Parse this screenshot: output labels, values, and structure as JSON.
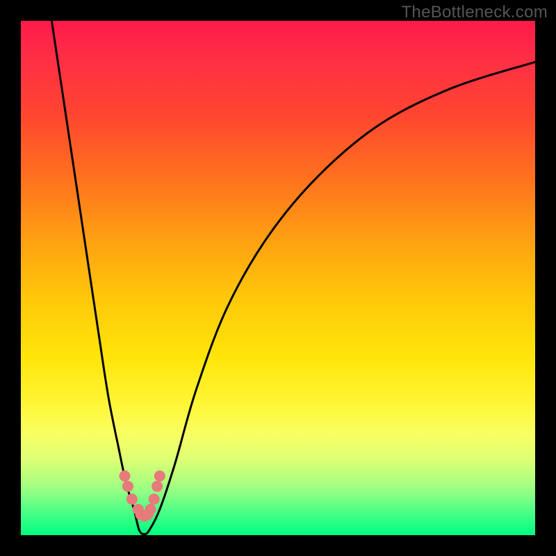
{
  "watermark": "TheBottleneck.com",
  "colors": {
    "gradient_top": "#ff1a4a",
    "gradient_mid": "#ffe409",
    "gradient_bottom": "#00ff80",
    "curve": "#000000",
    "beads": "#e77a7a",
    "frame": "#000000"
  },
  "chart_data": {
    "type": "line",
    "title": "",
    "xlabel": "",
    "ylabel": "",
    "xlim": [
      0,
      100
    ],
    "ylim": [
      0,
      100
    ],
    "grid": false,
    "legend": false,
    "series": [
      {
        "name": "bottleneck-curve",
        "x": [
          6,
          9,
          12,
          15,
          17,
          19,
          20.5,
          22,
          23,
          24,
          25,
          27,
          30,
          34,
          40,
          48,
          58,
          70,
          84,
          100
        ],
        "y": [
          100,
          80,
          60,
          40,
          27,
          17,
          10,
          5,
          1,
          0.2,
          1,
          5,
          14,
          28,
          44,
          58,
          70,
          80,
          87,
          92
        ]
      }
    ],
    "markers": {
      "name": "valley-beads",
      "x": [
        20.2,
        20.8,
        21.6,
        22.8,
        23.3,
        24.0,
        24.7,
        25.2,
        25.9,
        26.5,
        27.0
      ],
      "y": [
        11.5,
        9.5,
        7.0,
        5.0,
        4.0,
        3.7,
        4.0,
        5.0,
        7.0,
        9.5,
        11.5
      ]
    }
  }
}
